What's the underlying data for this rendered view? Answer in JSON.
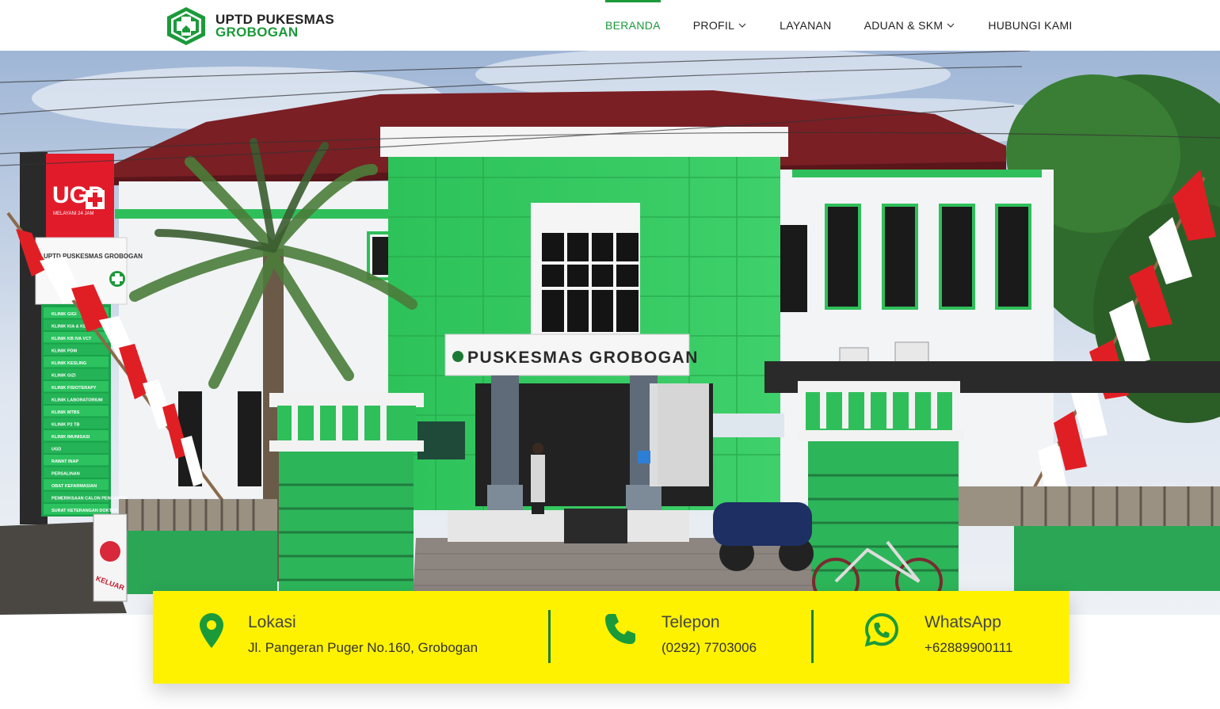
{
  "brand": {
    "line1": "UPTD PUKESMAS",
    "line2": "GROBOGAN",
    "logo_icon": "green-cross-logo-icon",
    "primary_color": "#1b9a3a"
  },
  "nav": {
    "beranda": "BERANDA",
    "profil": "PROFIL",
    "layanan": "LAYANAN",
    "aduan": "ADUAN & SKM",
    "hubungi": "HUBUNGI KAMI",
    "active": "BERANDA"
  },
  "hero": {
    "building_sign": "PUSKESMAS GROBOGAN",
    "ugd_sign": "UGD",
    "ugd_sub": "MELAYANI 24 JAM",
    "exit_sign": "KELUAR",
    "left_board_title": "UPTD PUSKESMAS GROBOGAN",
    "directory_items": [
      "KLINIK GIGI",
      "KLINIK KIA & KB",
      "KLINIK KB IVA VCT",
      "KLINIK PDM",
      "KLINIK KESLING",
      "KLINIK GIZI",
      "KLINIK FISIOTERAPY",
      "KLINIK LABORATORIUM",
      "KLINIK MTBS",
      "KLINIK P2 TB",
      "KLINIK IMUNISASI",
      "UGD",
      "RAWAT INAP",
      "PERSALINAN",
      "OBAT KEFARMASIAN",
      "PEMERIKSAAN CALON PENGANTIN",
      "SURAT KETERANGAN DOKTER"
    ]
  },
  "info": {
    "background": "#fff200",
    "icon_color": "#1b9a3a",
    "location": {
      "title": "Lokasi",
      "value": "Jl. Pangeran Puger No.160, Grobogan",
      "icon": "map-pin-icon"
    },
    "phone": {
      "title": "Telepon",
      "value": "(0292) 7703006",
      "icon": "phone-icon"
    },
    "whatsapp": {
      "title": "WhatsApp",
      "value": "+62889900111",
      "icon": "whatsapp-icon"
    }
  }
}
